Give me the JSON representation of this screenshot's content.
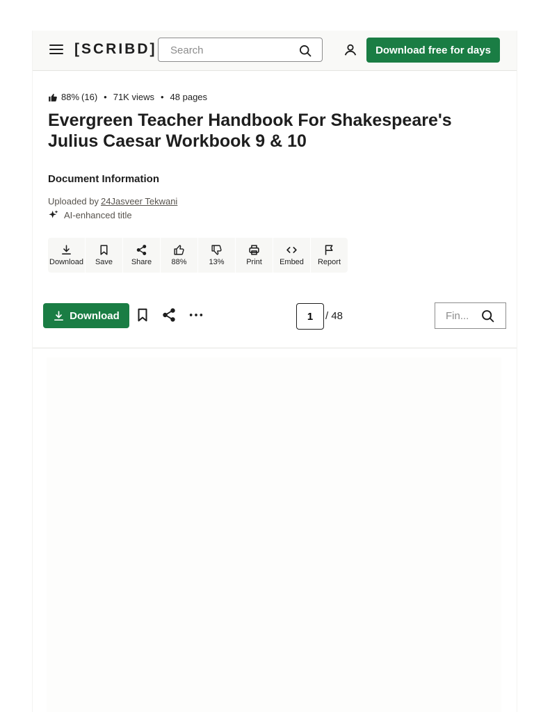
{
  "header": {
    "logo": "[SCRIBD]",
    "search_placeholder": "Search",
    "cta_label": "Download free for days"
  },
  "meta": {
    "rating_percent": "88%",
    "rating_count": "(16)",
    "views": "71K views",
    "pages": "48 pages"
  },
  "document": {
    "title": "Evergreen Teacher Handbook For Shakespeare's Julius Caesar Workbook 9 & 10",
    "info_heading": "Document Information",
    "uploaded_prefix": "Uploaded by",
    "uploader": "24Jasveer Tekwani",
    "ai_label": "AI-enhanced title"
  },
  "actions": [
    {
      "label": "Download",
      "icon": "download-icon"
    },
    {
      "label": "Save",
      "icon": "bookmark-icon"
    },
    {
      "label": "Share",
      "icon": "share-icon"
    },
    {
      "label": "88%",
      "icon": "thumbs-up-icon"
    },
    {
      "label": "13%",
      "icon": "thumbs-down-icon"
    },
    {
      "label": "Print",
      "icon": "print-icon"
    },
    {
      "label": "Embed",
      "icon": "embed-icon"
    },
    {
      "label": "Report",
      "icon": "flag-icon"
    }
  ],
  "toolbar": {
    "download_label": "Download",
    "page_current": "1",
    "page_total": "/ 48",
    "find_placeholder": "Fin..."
  },
  "colors": {
    "accent": "#1a7d44",
    "header_bg": "#f9f9f7",
    "text": "#1e1e1e"
  }
}
